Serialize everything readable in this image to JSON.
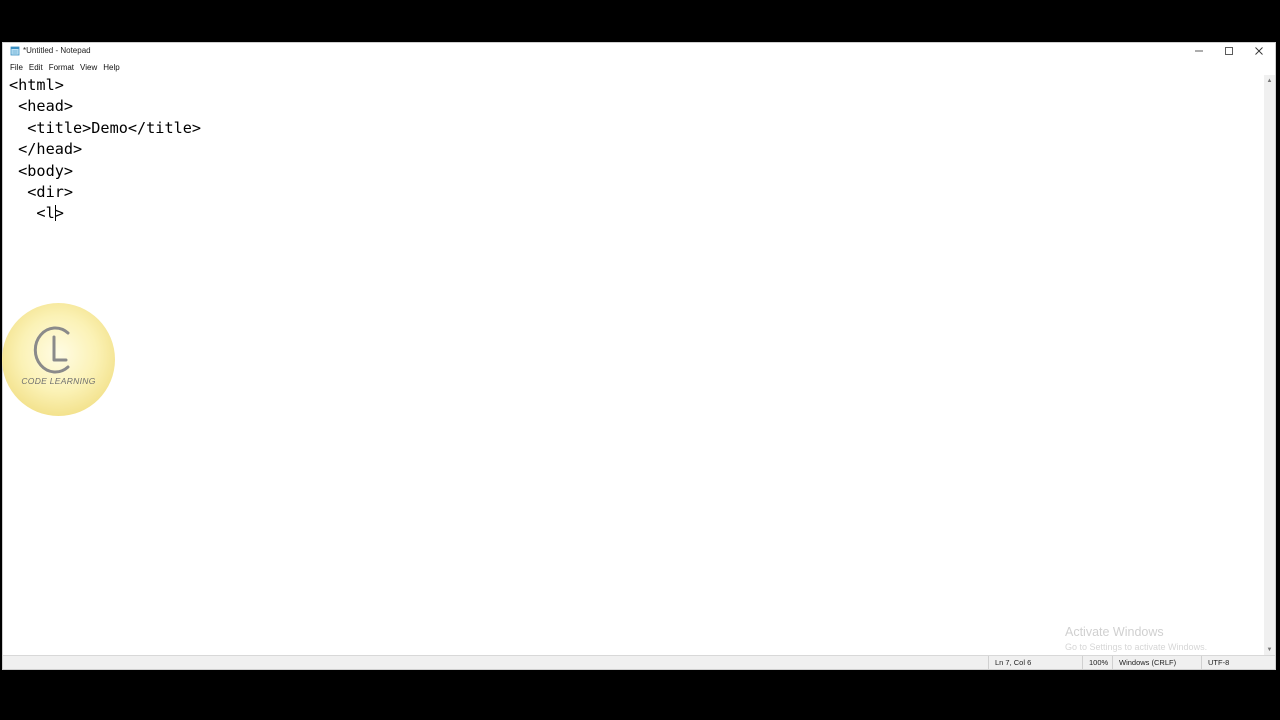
{
  "window": {
    "title": "*Untitled - Notepad"
  },
  "menu": {
    "items": [
      "File",
      "Edit",
      "Format",
      "View",
      "Help"
    ]
  },
  "editor": {
    "lines": [
      "<html>",
      " <head>",
      "  <title>Demo</title>",
      " </head>",
      " <body>",
      "  <dir>",
      "   <l"
    ],
    "line7_after_caret": ">"
  },
  "status": {
    "position": "Ln 7, Col 6",
    "zoom": "100%",
    "line_ending": "Windows (CRLF)",
    "encoding": "UTF-8"
  },
  "watermark": {
    "title": "Activate Windows",
    "subtitle": "Go to Settings to activate Windows."
  },
  "logo": {
    "text": "CODE LEARNING"
  },
  "icons": {
    "app": "notepad-icon",
    "minimize": "minimize-icon",
    "maximize": "maximize-icon",
    "close": "close-icon"
  },
  "colors": {
    "background": "#000000",
    "window": "#ffffff",
    "statusbar": "#f0f0f0",
    "logo_gold": "#f0dc7e"
  }
}
